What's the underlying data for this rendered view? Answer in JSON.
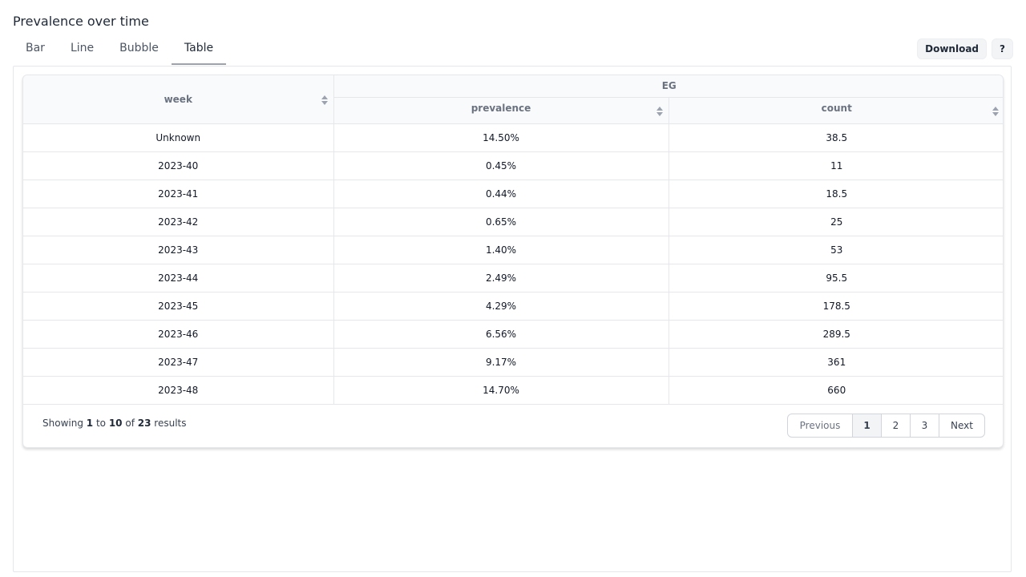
{
  "title": "Prevalence over time",
  "tabs": [
    {
      "label": "Bar"
    },
    {
      "label": "Line"
    },
    {
      "label": "Bubble"
    },
    {
      "label": "Table"
    }
  ],
  "active_tab": "Table",
  "toolbar": {
    "download_label": "Download",
    "help_label": "?"
  },
  "table": {
    "group_header": "EG",
    "columns": [
      "week",
      "prevalence",
      "count"
    ],
    "rows": [
      {
        "week": "Unknown",
        "prevalence": "14.50%",
        "count": "38.5"
      },
      {
        "week": "2023-40",
        "prevalence": "0.45%",
        "count": "11"
      },
      {
        "week": "2023-41",
        "prevalence": "0.44%",
        "count": "18.5"
      },
      {
        "week": "2023-42",
        "prevalence": "0.65%",
        "count": "25"
      },
      {
        "week": "2023-43",
        "prevalence": "1.40%",
        "count": "53"
      },
      {
        "week": "2023-44",
        "prevalence": "2.49%",
        "count": "95.5"
      },
      {
        "week": "2023-45",
        "prevalence": "4.29%",
        "count": "178.5"
      },
      {
        "week": "2023-46",
        "prevalence": "6.56%",
        "count": "289.5"
      },
      {
        "week": "2023-47",
        "prevalence": "9.17%",
        "count": "361"
      },
      {
        "week": "2023-48",
        "prevalence": "14.70%",
        "count": "660"
      }
    ]
  },
  "pagination": {
    "showing_prefix": "Showing",
    "from": "1",
    "to_word": "to",
    "to": "10",
    "of_word": "of",
    "total": "23",
    "suffix": "results",
    "previous_label": "Previous",
    "pages": [
      "1",
      "2",
      "3"
    ],
    "current_page": "1",
    "next_label": "Next"
  },
  "colors": {
    "accent_border": "#9ca3af",
    "header_bg": "#f9fafb",
    "grid_line": "#e5e7eb"
  }
}
